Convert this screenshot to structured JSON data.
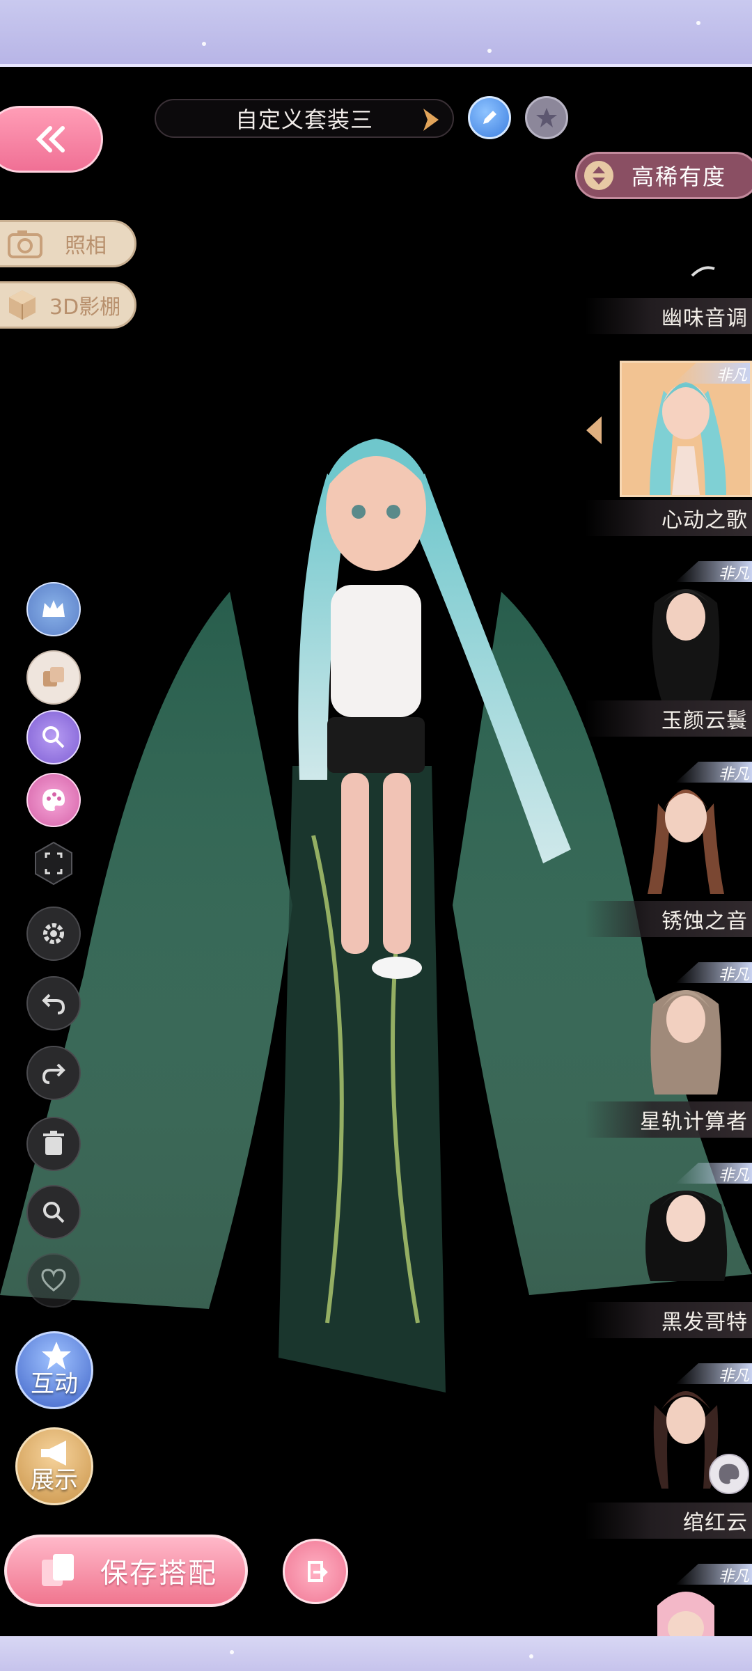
{
  "outfit": {
    "name": "自定义套装三"
  },
  "sort": {
    "label": "高稀有度"
  },
  "left_panel": {
    "photo_label": "照相",
    "studio_label": "3D影棚"
  },
  "actions": {
    "interact_label": "互动",
    "show_label": "展示",
    "save_label": "保存搭配"
  },
  "items": [
    {
      "name": "幽味音调",
      "tag": ""
    },
    {
      "name": "心动之歌",
      "tag": "非凡",
      "selected": true
    },
    {
      "name": "玉颜云鬟",
      "tag": "非凡"
    },
    {
      "name": "锈蚀之音",
      "tag": "非凡"
    },
    {
      "name": "星轨计算者",
      "tag": "非凡"
    },
    {
      "name": "黑发哥特",
      "tag": "非凡"
    },
    {
      "name": "绾红云",
      "tag": "非凡"
    },
    {
      "name": "",
      "tag": "非凡"
    }
  ],
  "colors": {
    "accent_pink": "#f07693",
    "panel_black": "#000000",
    "sort_pill": "#8a4f63"
  }
}
